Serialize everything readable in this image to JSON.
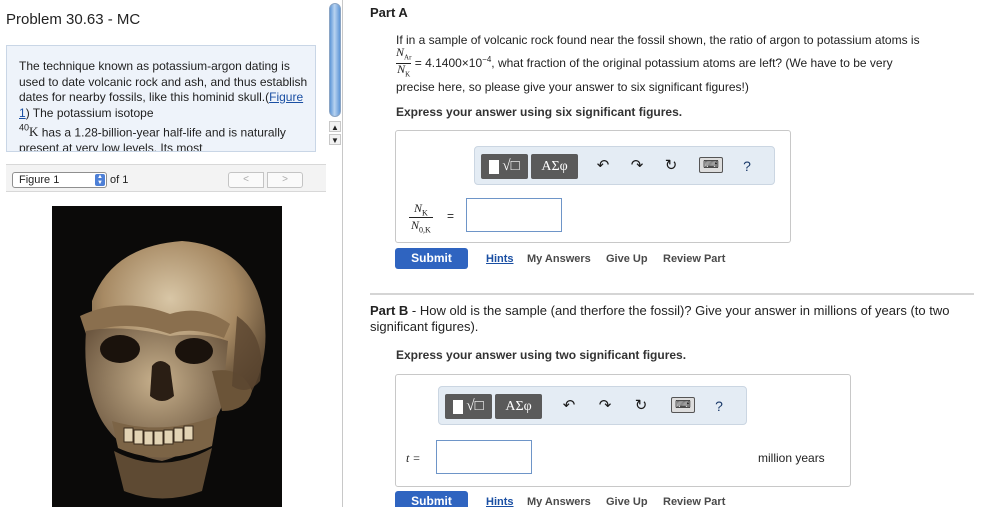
{
  "problem": {
    "title": "Problem 30.63 - MC",
    "description_1": "The technique known as potassium-argon dating is used to date volcanic rock and ash, and thus establish dates for nearby fossils, like this hominid skull.(",
    "figure_link": "Figure 1",
    "description_2": ") The potassium isotope ",
    "isotope_mass": "40",
    "isotope_symbol": "K",
    "description_3": " has a 1.28-billion-year half-life and is naturally present at very low levels. Its most"
  },
  "figure_nav": {
    "select_value": "Figure 1",
    "of_label": "of 1",
    "prev": "<",
    "next": ">"
  },
  "partA": {
    "title": "Part A",
    "prompt_1": "If in a sample of volcanic rock found near the fossil shown, the ratio of argon to potassium atoms is",
    "ratio_num": "N",
    "ratio_num_sub": "Ar",
    "ratio_den": "N",
    "ratio_den_sub": "K",
    "ratio_value": "= 4.1400×10",
    "ratio_exp": "−4",
    "prompt_2": ", what fraction of the original potassium atoms are left? (We have to be very",
    "prompt_3": "precise here, so please give your answer to six significant figures!)",
    "instruction": "Express your answer using six significant figures.",
    "lhs_num": "N",
    "lhs_num_sub": "K",
    "lhs_den": "N",
    "lhs_den_sub": "0,K",
    "equals": "=",
    "input_value": "",
    "submit": "Submit",
    "hints": "Hints",
    "my_answers": "My Answers",
    "give_up": "Give Up",
    "review_part": "Review Part"
  },
  "partB": {
    "title": "Part B",
    "title_rest": " - How old is the sample (and therfore the fossil)? Give your answer in millions of years (to two significant figures).",
    "instruction": "Express your answer using two significant figures.",
    "lhs": "t =",
    "input_value": "",
    "unit": "million years",
    "submit": "Submit",
    "hints": "Hints",
    "my_answers": "My Answers",
    "give_up": "Give Up",
    "review_part": "Review Part"
  },
  "toolbar": {
    "templates_label": "√□",
    "symbols_label": "ΑΣφ",
    "undo_icon": "undo-icon",
    "redo_icon": "redo-icon",
    "reset_icon": "reset-icon",
    "keyboard_icon": "keyboard-icon",
    "help_label": "?"
  },
  "scroll": {
    "up": "▲",
    "down": "▼"
  }
}
